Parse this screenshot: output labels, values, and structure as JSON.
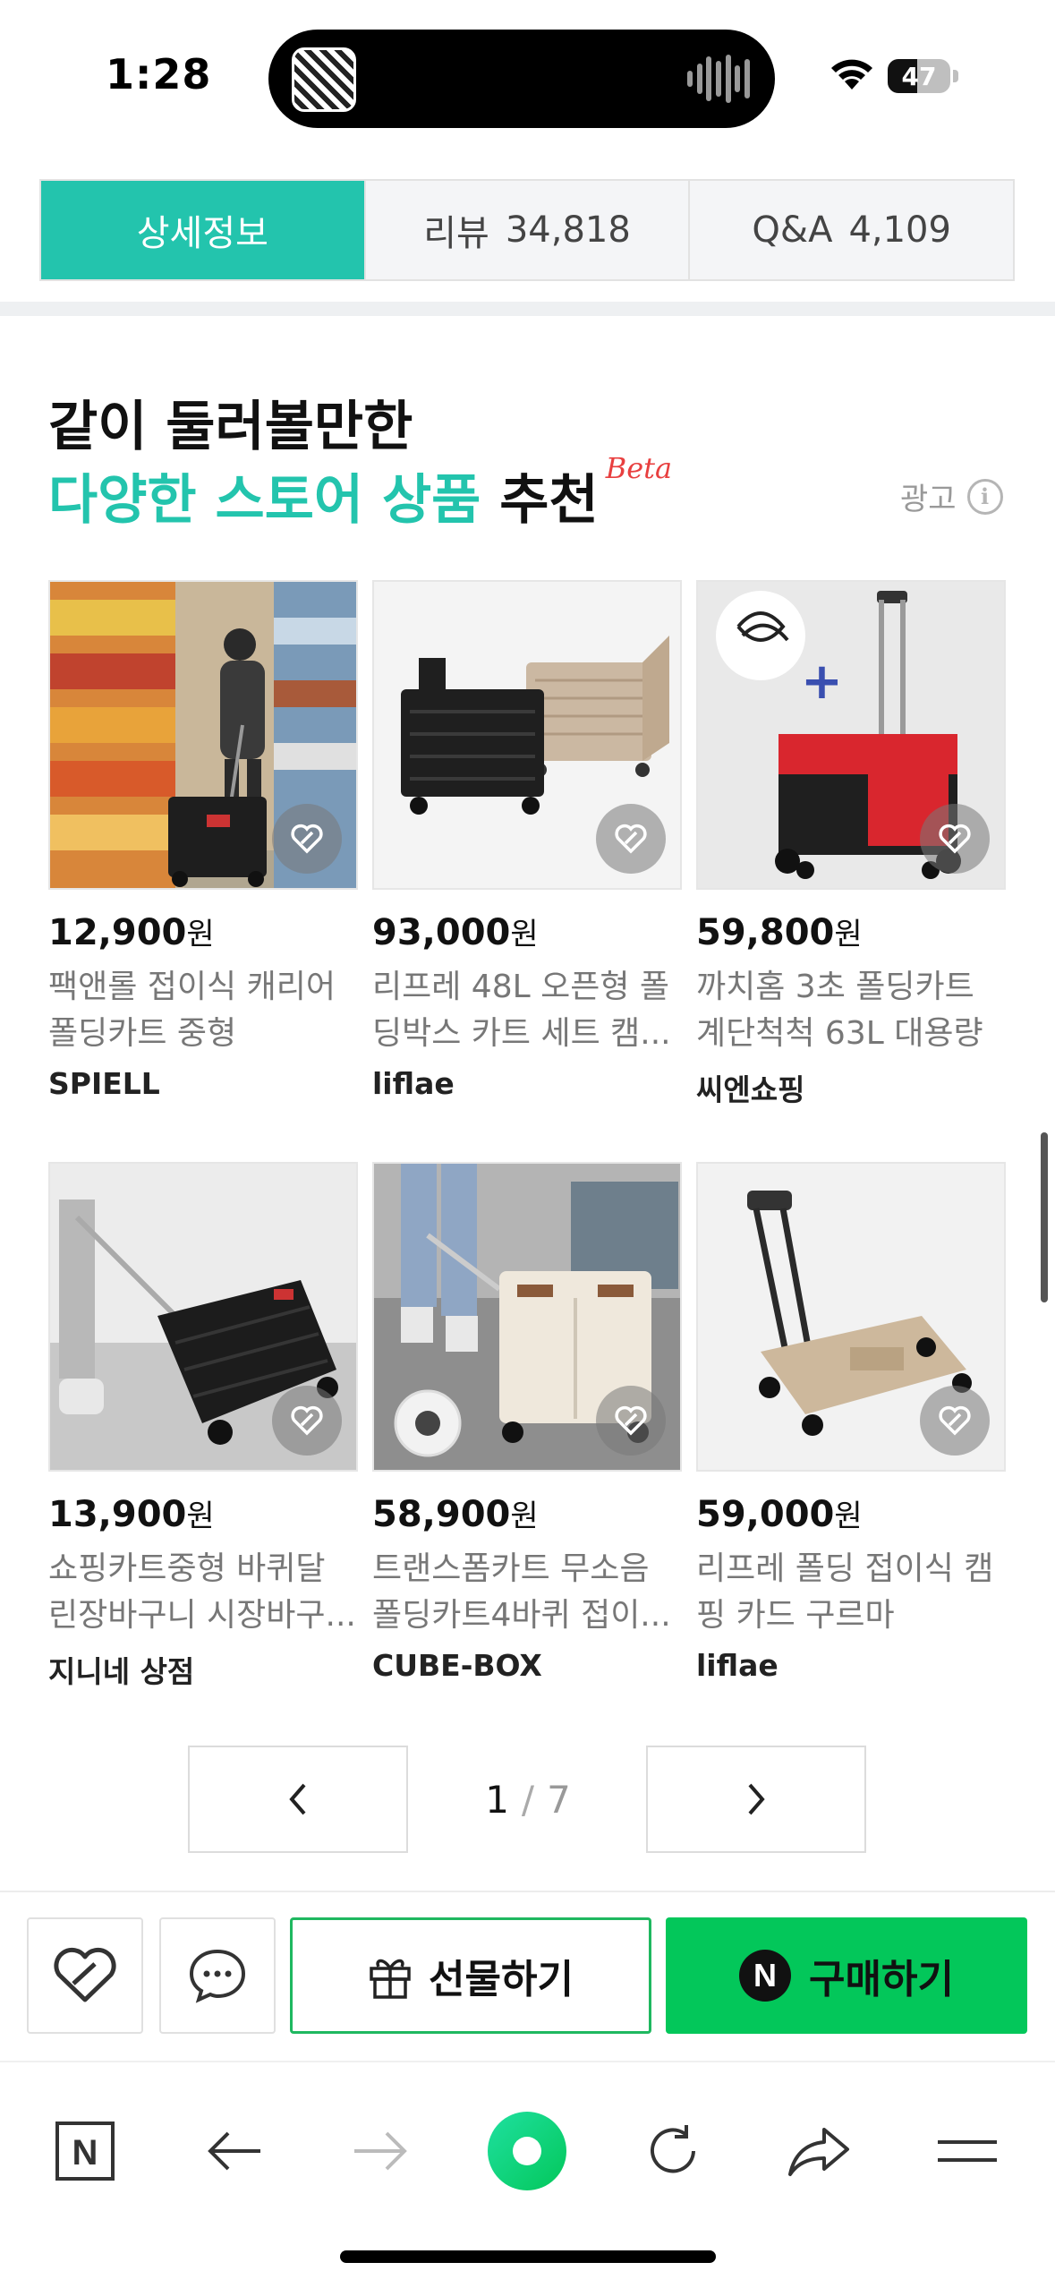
{
  "status_bar": {
    "time": "1:28",
    "battery": "47",
    "battery_level": 0.47
  },
  "tabs": [
    {
      "label": "상세정보",
      "count": "",
      "active": true
    },
    {
      "label": "리뷰",
      "count": "34,818",
      "active": false
    },
    {
      "label": "Q&A",
      "count": "4,109",
      "active": false
    }
  ],
  "recommend": {
    "title_line1": "같이 둘러볼만한",
    "title_accent": "다양한 스토어 상품",
    "title_rest": " 추천",
    "beta": "Beta",
    "ad_label": "광고",
    "info_glyph": "i"
  },
  "products": [
    {
      "price": "12,900",
      "won": "원",
      "name_line1": "팩앤롤 접이식 캐리어",
      "name_line2": "폴딩카트 중형",
      "store": "SPIELL"
    },
    {
      "price": "93,000",
      "won": "원",
      "name_line1": "리프레 48L 오픈형 폴",
      "name_line2": "딩박스 카트 세트 캠...",
      "store": "liflae"
    },
    {
      "price": "59,800",
      "won": "원",
      "name_line1": "까치홈 3초 폴딩카트",
      "name_line2": "계단척척 63L 대용량",
      "store": "씨엔쇼핑"
    },
    {
      "price": "13,900",
      "won": "원",
      "name_line1": "쇼핑카트중형 바퀴달",
      "name_line2": "린장바구니 시장바구...",
      "store": "지니네 상점"
    },
    {
      "price": "58,900",
      "won": "원",
      "name_line1": "트랜스폼카트 무소음",
      "name_line2": "폴딩카트4바퀴 접이...",
      "store": "CUBE-BOX"
    },
    {
      "price": "59,000",
      "won": "원",
      "name_line1": "리프레 폴딩 접이식 캠",
      "name_line2": "핑 카드 구르마",
      "store": "liflae"
    }
  ],
  "pager": {
    "current": "1",
    "separator": "/",
    "total": "7"
  },
  "buy_bar": {
    "gift_label": "선물하기",
    "buy_label": "구매하기",
    "buy_logo": "N"
  },
  "toolbar": {
    "home_logo": "N"
  },
  "colors": {
    "accent": "#23c4ad",
    "buy_green": "#03c75a",
    "beta_red": "#e83f3f"
  }
}
